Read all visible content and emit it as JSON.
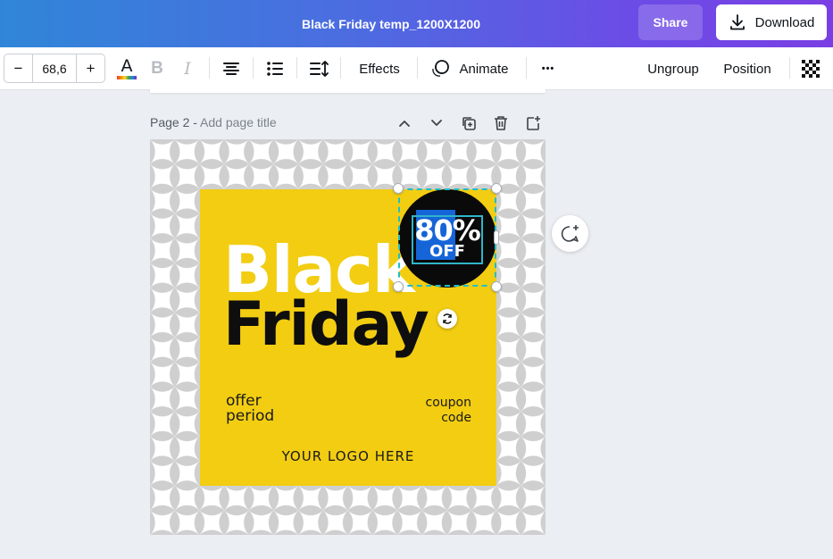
{
  "header": {
    "doc_title": "Black Friday temp_1200X1200",
    "share_label": "Share",
    "download_label": "Download"
  },
  "toolbar": {
    "font_size": "68,6",
    "decrease_label": "−",
    "increase_label": "+",
    "text_color_glyph": "A",
    "bold_glyph": "B",
    "italic_glyph": "I",
    "effects_label": "Effects",
    "animate_label": "Animate",
    "more_glyph": "•••",
    "ungroup_label": "Ungroup",
    "position_label": "Position"
  },
  "page": {
    "label": "Page 2 - ",
    "add_title": "Add page title"
  },
  "design": {
    "headline_1": "Black",
    "headline_2": "Friday",
    "offer_line_1": "offer",
    "offer_line_2": "period",
    "coupon_line_1": "coupon",
    "coupon_line_2": "code",
    "logo_text": "YOUR LOGO HERE",
    "badge_percent": "80%",
    "badge_off": "OFF"
  },
  "colors": {
    "card_yellow": "#f2cd12",
    "badge_black": "#0a0a0a",
    "badge_highlight": "#1565d8",
    "selection_teal": "#1dbfc9",
    "topbar_start": "#2f86d8",
    "topbar_end": "#7a3fe4"
  },
  "icons": {
    "download": "download-icon",
    "align_center": "align-center-icon",
    "list": "bullet-list-icon",
    "spacing": "line-spacing-icon",
    "animate": "animate-icon",
    "transparency": "transparency-icon",
    "chevron_up": "chevron-up-icon",
    "chevron_down": "chevron-down-icon",
    "duplicate": "duplicate-page-icon",
    "delete": "trash-icon",
    "add_page": "add-page-icon",
    "rotate": "rotate-icon",
    "comment": "add-comment-icon"
  }
}
